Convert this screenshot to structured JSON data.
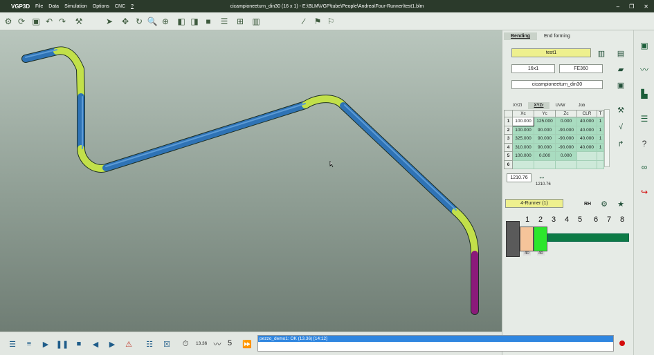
{
  "app": {
    "name": "VGP3D",
    "window_title": "cicampioneeturn_din30 (16 x 1) - E:\\BLM\\VGP\\tube\\People\\Andrea\\Four-Runner\\test1.blm"
  },
  "menu": [
    "File",
    "Data",
    "Simulation",
    "Options",
    "CNC",
    "?"
  ],
  "window_buttons": {
    "minimize": "–",
    "maximize": "❐",
    "close": "✕"
  },
  "panel": {
    "tabs": [
      "Bending",
      "End forming"
    ],
    "name_field": "test1",
    "size_field": "16x1",
    "material_field": "FE360",
    "part_field": "cicampioneeturn_din30",
    "coord_tabs": [
      "XYZl",
      "XYZr",
      "UVW",
      "Job"
    ],
    "headers": [
      "",
      "Xc",
      "Yc",
      "Zc",
      "CLR",
      "T"
    ],
    "rows": [
      [
        "1",
        "100.000",
        "125.000",
        "0.000",
        "40.000",
        "1"
      ],
      [
        "2",
        "100.000",
        "90.000",
        "-90.000",
        "40.000",
        "1"
      ],
      [
        "3",
        "325.000",
        "90.000",
        "-90.000",
        "40.000",
        "1"
      ],
      [
        "4",
        "310.000",
        "90.000",
        "-90.000",
        "40.000",
        "1"
      ],
      [
        "5",
        "100.000",
        "0.000",
        "0.000",
        "",
        ""
      ],
      [
        "6",
        "",
        "",
        "",
        "",
        ""
      ]
    ],
    "length_value": "1210.76",
    "length_label": "1210.76",
    "runner_field": "4-Runner (1)",
    "rh_label": "RH",
    "runner_numbers": [
      "1",
      "2",
      "3",
      "4",
      "5",
      "6",
      "7",
      "8"
    ],
    "runner_values": [
      "40",
      "40"
    ]
  },
  "bottom": {
    "time": "13.36",
    "count": "5"
  },
  "status_line": "pezzo_demo1: OK (13.36) [14:12]",
  "colors": {
    "tube_straight": "#2f73b5",
    "tube_bend": "#c2e04a",
    "tube_end": "#8b1a7a"
  }
}
